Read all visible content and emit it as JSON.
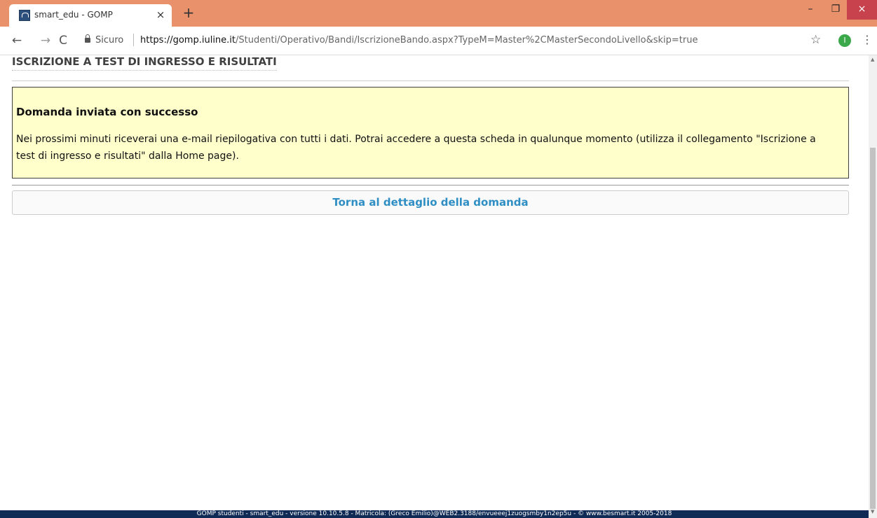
{
  "browser": {
    "tab_title": "smart_edu - GOMP",
    "tab_close": "×",
    "new_tab": "+",
    "win_minimize": "–",
    "win_maximize": "❐",
    "win_close": "×",
    "back": "←",
    "forward": "→",
    "reload": "C",
    "secure_label": "Sicuro",
    "url_host": "https://gomp.iuline.it",
    "url_path": "/Studenti/Operativo/Bandi/IscrizioneBando.aspx?TypeM=Master%2CMasterSecondoLivello&skip=true",
    "star": "☆",
    "profile_initial": "I",
    "menu": "⋮",
    "theme_color": "#E8916A"
  },
  "page": {
    "title": "ISCRIZIONE A TEST DI INGRESSO E RISULTATI",
    "alert": {
      "title": "Domanda inviata con successo",
      "text": "Nei prossimi minuti riceverai una e-mail riepilogativa con tutti i dati. Potrai accedere a questa scheda in qualunque momento (utilizza il collegamento \"Iscrizione a test di ingresso e risultati\" dalla Home page).",
      "background": "#FFFFCC"
    },
    "back_button_label": "Torna al dettaglio della domanda",
    "link_color": "#2F8FC4"
  },
  "footer": {
    "text": "GOMP studenti - smart_edu - versione 10.10.5.8 - Matricola: (Greco Emilio)@WEB2.3188/envueeej1zuogsmby1n2ep5u - © www.besmart.it 2005-2018",
    "background": "#0F2A55"
  }
}
